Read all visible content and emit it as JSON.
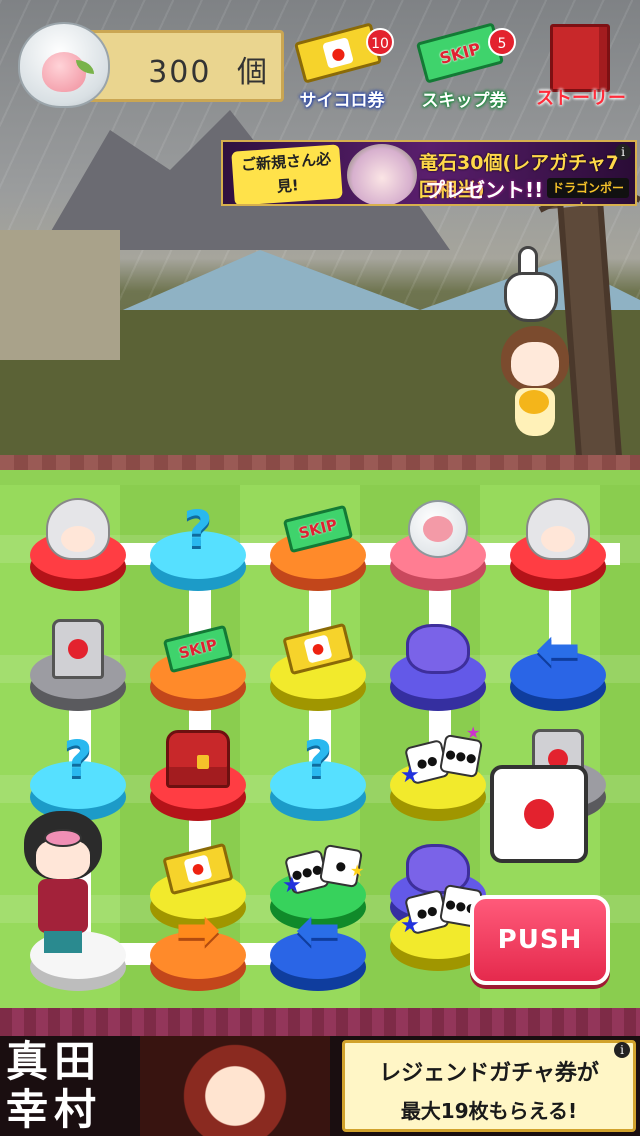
{
  "hud": {
    "coin_count": "300",
    "coin_unit": "個",
    "dice_ticket": {
      "label": "サイコロ券",
      "badge": "10",
      "icon": "dice-ticket-icon"
    },
    "skip_ticket": {
      "label": "スキップ券",
      "badge": "5",
      "tag": "SKIP",
      "icon": "skip-ticket-icon"
    },
    "story": {
      "label": "ストーリー",
      "icon": "book-icon"
    }
  },
  "ad_top": {
    "sub": "ご新規さん必見!",
    "main": "竜石30個(レアガチャ7回相当)",
    "main2": "プレゼント!!",
    "logo": "ドラゴンポーカー",
    "info": "i"
  },
  "board": {
    "tiles": [
      {
        "id": "r0c0",
        "color": "red",
        "content": "chibi",
        "icon": "chibi-girl-icon"
      },
      {
        "id": "r0c1",
        "color": "cyan",
        "content": "?",
        "icon": "question-icon"
      },
      {
        "id": "r0c2",
        "color": "orange",
        "content": "SKIP",
        "icon": "skip-ticket-icon"
      },
      {
        "id": "r0c3",
        "color": "pink",
        "content": "peach",
        "icon": "peach-bag-icon"
      },
      {
        "id": "r0c4",
        "color": "red",
        "content": "chibi",
        "icon": "chibi-girl-icon"
      },
      {
        "id": "r1c0",
        "color": "gray",
        "content": "tomb",
        "icon": "tombstone-icon"
      },
      {
        "id": "r1c1",
        "color": "orange",
        "content": "SKIP",
        "icon": "skip-ticket-icon"
      },
      {
        "id": "r1c2",
        "color": "yellow",
        "content": "dice-ticket",
        "icon": "dice-ticket-icon"
      },
      {
        "id": "r1c3",
        "color": "purple",
        "content": "cloud",
        "icon": "cloud-icon"
      },
      {
        "id": "r1c4",
        "color": "blue",
        "content": "←",
        "icon": "arrow-left-icon"
      },
      {
        "id": "r2c0",
        "color": "cyan",
        "content": "?",
        "icon": "question-icon"
      },
      {
        "id": "r2c1",
        "color": "red",
        "content": "chest",
        "icon": "treasure-chest-icon"
      },
      {
        "id": "r2c2",
        "color": "cyan",
        "content": "?",
        "icon": "question-icon"
      },
      {
        "id": "r2c3",
        "color": "yellow",
        "content": "dice",
        "icon": "dice-pair-icon"
      },
      {
        "id": "r2c4",
        "color": "gray",
        "content": "tomb",
        "icon": "tombstone-icon"
      },
      {
        "id": "r3c1",
        "color": "yellow",
        "content": "dice-ticket",
        "icon": "dice-ticket-icon"
      },
      {
        "id": "r3c2",
        "color": "green",
        "content": "dice",
        "icon": "dice-pair-icon"
      },
      {
        "id": "r3c3",
        "color": "purple",
        "content": "cloud",
        "icon": "cloud-icon"
      },
      {
        "id": "r4c0",
        "color": "white",
        "content": "player",
        "icon": "player-icon"
      },
      {
        "id": "r4c1",
        "color": "orange",
        "content": "→",
        "icon": "arrow-right-icon"
      },
      {
        "id": "r4c2",
        "color": "blue",
        "content": "←",
        "icon": "arrow-left-icon"
      },
      {
        "id": "r4c3",
        "color": "yellow",
        "content": "dice",
        "icon": "dice-pair-icon"
      }
    ],
    "dice_result": 1,
    "push_label": "PUSH"
  },
  "ad_bottom": {
    "name": "真田幸村",
    "line1": "レジェンドガチャ券が",
    "line2": "最大19枚もらえる!",
    "info": "i"
  },
  "colors": {
    "board_green": "#8fd155",
    "push_red": "#e52a4d",
    "badge_red": "#e3222e"
  }
}
